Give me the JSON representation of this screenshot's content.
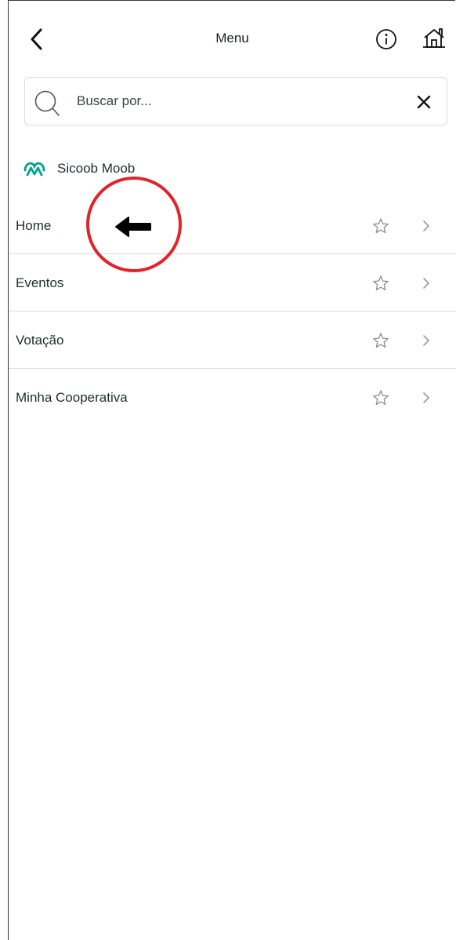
{
  "header": {
    "title": "Menu",
    "back_icon": "chevron-left-icon",
    "info_icon": "info-icon",
    "home_icon": "home-icon"
  },
  "search": {
    "placeholder": "Buscar por...",
    "value": "",
    "search_icon": "search-icon",
    "clear_icon": "close-icon"
  },
  "brand": {
    "name": "Sicoob Moob",
    "logo_icon": "sicoob-moob-logo",
    "color": "#00a091"
  },
  "menu": {
    "items": [
      {
        "label": "Home",
        "favorite": false
      },
      {
        "label": "Eventos",
        "favorite": false
      },
      {
        "label": "Votação",
        "favorite": false
      },
      {
        "label": "Minha Cooperativa",
        "favorite": false
      }
    ]
  },
  "annotation": {
    "circle_color": "#e0242a",
    "arrow_icon": "arrow-left-icon",
    "arrow_color": "#000000"
  }
}
